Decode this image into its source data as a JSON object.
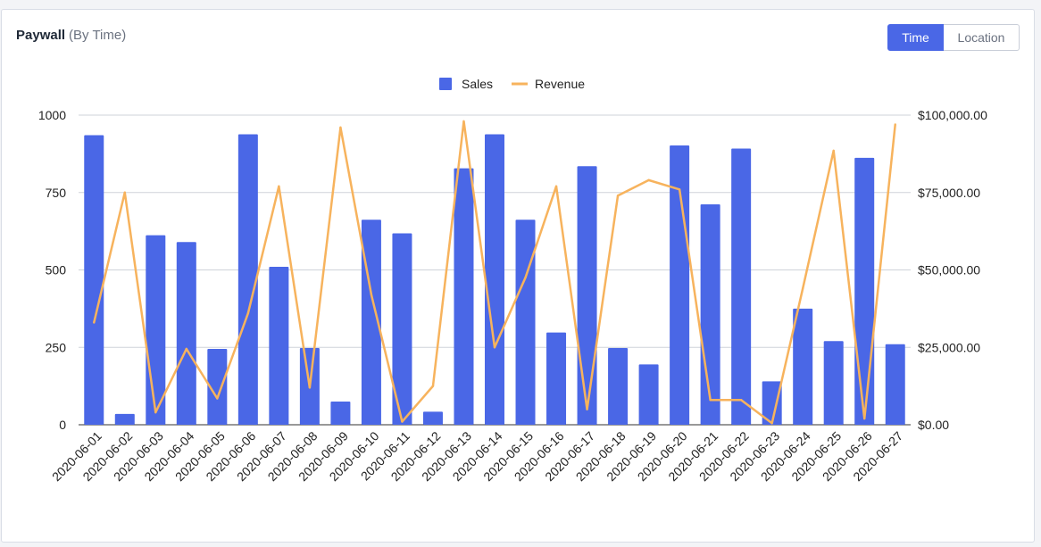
{
  "card": {
    "title": "Paywall",
    "subtitle": "(By Time)"
  },
  "toggle": {
    "time_label": "Time",
    "location_label": "Location",
    "selected": "Time"
  },
  "colors": {
    "bar": "#4a67e6",
    "line": "#f7b35d",
    "grid": "#cfd3da",
    "axis_text": "#222222"
  },
  "chart_data": {
    "type": "bar",
    "title": "",
    "xlabel": "",
    "ylabel": "",
    "y2label": "",
    "legend_position": "top-center",
    "grid": true,
    "categories": [
      "2020-06-01",
      "2020-06-02",
      "2020-06-03",
      "2020-06-04",
      "2020-06-05",
      "2020-06-06",
      "2020-06-07",
      "2020-06-08",
      "2020-06-09",
      "2020-06-10",
      "2020-06-11",
      "2020-06-12",
      "2020-06-13",
      "2020-06-14",
      "2020-06-15",
      "2020-06-16",
      "2020-06-17",
      "2020-06-18",
      "2020-06-19",
      "2020-06-20",
      "2020-06-21",
      "2020-06-22",
      "2020-06-23",
      "2020-06-24",
      "2020-06-25",
      "2020-06-26",
      "2020-06-27"
    ],
    "series": [
      {
        "name": "Sales",
        "type": "bar",
        "axis": "left",
        "values": [
          935,
          35,
          612,
          590,
          245,
          938,
          510,
          248,
          75,
          662,
          618,
          42,
          828,
          938,
          662,
          298,
          835,
          248,
          195,
          902,
          712,
          892,
          140,
          375,
          270,
          862,
          260
        ]
      },
      {
        "name": "Revenue",
        "type": "line",
        "axis": "right",
        "values": [
          33000,
          75000,
          4000,
          24500,
          8500,
          36000,
          77000,
          12000,
          96000,
          42000,
          1000,
          12500,
          98000,
          25000,
          47500,
          77000,
          5000,
          74000,
          79000,
          76000,
          8000,
          8000,
          500,
          44000,
          88500,
          2000,
          97000
        ]
      }
    ],
    "ylim": [
      0,
      1000
    ],
    "y_ticks": [
      0,
      250,
      500,
      750,
      1000
    ],
    "y_tick_labels": [
      "0",
      "250",
      "500",
      "750",
      "1000"
    ],
    "y2lim": [
      0,
      100000
    ],
    "y2_ticks": [
      0,
      25000,
      50000,
      75000,
      100000
    ],
    "y2_tick_labels": [
      "$0.00",
      "$25,000.00",
      "$50,000.00",
      "$75,000.00",
      "$100,000.00"
    ]
  }
}
